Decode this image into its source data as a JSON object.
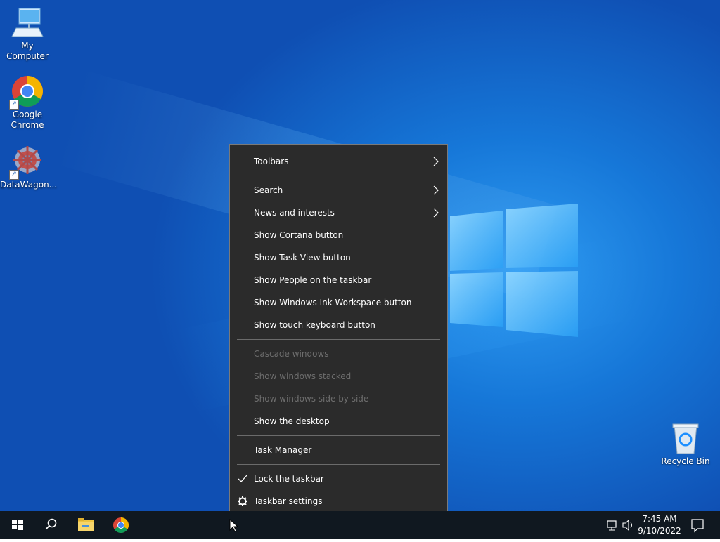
{
  "desktop": {
    "icons": [
      {
        "label": "My Computer",
        "icon": "computer-icon"
      },
      {
        "label": "Google Chrome",
        "icon": "chrome-icon"
      },
      {
        "label": "DataWagon...",
        "icon": "datawagon-icon"
      },
      {
        "label": "Recycle Bin",
        "icon": "recycle-bin-icon"
      }
    ]
  },
  "context_menu": {
    "items": [
      {
        "label": "Toolbars",
        "submenu": true
      },
      {
        "label": "Search",
        "submenu": true
      },
      {
        "label": "News and interests",
        "submenu": true
      },
      {
        "label": "Show Cortana button"
      },
      {
        "label": "Show Task View button"
      },
      {
        "label": "Show People on the taskbar"
      },
      {
        "label": "Show Windows Ink Workspace button"
      },
      {
        "label": "Show touch keyboard button"
      },
      {
        "label": "Cascade windows",
        "disabled": true
      },
      {
        "label": "Show windows stacked",
        "disabled": true
      },
      {
        "label": "Show windows side by side",
        "disabled": true
      },
      {
        "label": "Show the desktop"
      },
      {
        "label": "Task Manager"
      },
      {
        "label": "Lock the taskbar",
        "checked": true
      },
      {
        "label": "Taskbar settings",
        "icon": "gear-icon"
      }
    ]
  },
  "taskbar": {
    "clock": {
      "time": "7:45 AM",
      "date": "9/10/2022"
    },
    "pinned": [
      "start-icon",
      "search-icon",
      "file-explorer-icon",
      "chrome-icon"
    ],
    "tray": [
      "network-icon",
      "volume-icon",
      "notification-icon"
    ]
  },
  "colors": {
    "menu_bg": "#2b2b2b",
    "taskbar_bg": "#101820",
    "desktop_accent": "#1677d8"
  }
}
